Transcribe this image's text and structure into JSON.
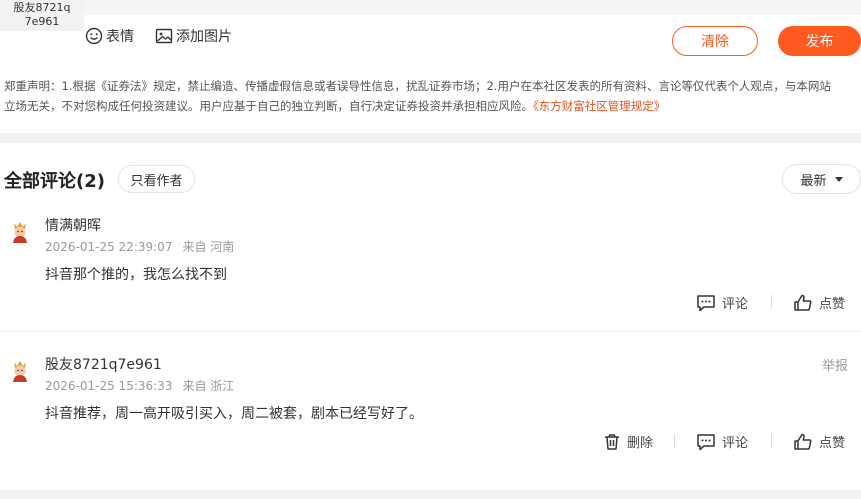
{
  "user_chip": {
    "line1": "股友8721q",
    "line2": "7e961"
  },
  "editor": {
    "emoji_label": "表情",
    "image_label": "添加图片",
    "clear_label": "清除",
    "publish_label": "发布"
  },
  "disclaimer": {
    "line1": "郑重声明：1.根据《证券法》规定，禁止编造、传播虚假信息或者误导性信息，扰乱证券市场；2.用户在本社区发表的所有资料、言论等仅代表个人观点，与本网站",
    "line2": "立场无关，不对您构成任何投资建议。用户应基于自己的独立判断，自行决定证券投资并承担相应风险。",
    "link": "《东方财富社区管理规定》"
  },
  "comments": {
    "title": "全部评论(2)",
    "author_only": "只看作者",
    "sort": "最新",
    "accent_color": "#ff5a1f",
    "items": [
      {
        "name": "情满朝晖",
        "time": "2026-01-25 22:39:07",
        "location": "来自 河南",
        "text": "抖音那个推的，我怎么找不到",
        "comment_label": "评论",
        "like_label": "点赞"
      },
      {
        "name": "股友8721q7e961",
        "time": "2026-01-25 15:36:33",
        "location": "来自 浙江",
        "text": "抖音推荐，周一高开吸引买入，周二被套，剧本已经写好了。",
        "report_label": "举报",
        "delete_label": "删除",
        "comment_label": "评论",
        "like_label": "点赞"
      }
    ]
  }
}
